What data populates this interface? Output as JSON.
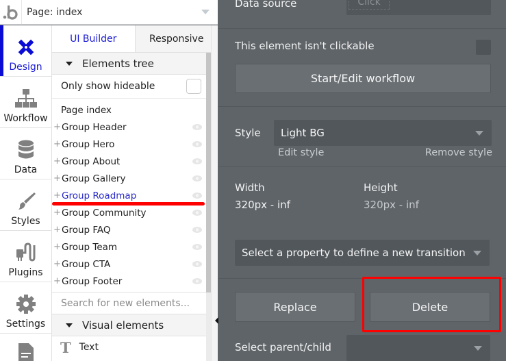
{
  "header": {
    "logo_icon": "bubble-logo-icon",
    "page_selector": "Page: index"
  },
  "rail": {
    "items": [
      {
        "label": "Design",
        "icon": "design-tools-icon",
        "active": true
      },
      {
        "label": "Workflow",
        "icon": "workflow-tree-icon",
        "active": false
      },
      {
        "label": "Data",
        "icon": "database-icon",
        "active": false
      },
      {
        "label": "Styles",
        "icon": "paintbrush-icon",
        "active": false
      },
      {
        "label": "Plugins",
        "icon": "plug-icon",
        "active": false
      },
      {
        "label": "Settings",
        "icon": "gear-icon",
        "active": false
      },
      {
        "label": "",
        "icon": "document-icon",
        "active": false
      }
    ]
  },
  "elements_panel": {
    "tabs": [
      {
        "label": "UI Builder",
        "active": true
      },
      {
        "label": "Responsive",
        "active": false
      }
    ],
    "elements_tree_header": "Elements tree",
    "only_show_hideable": "Only show hideable",
    "root": "Page index",
    "tree_items": [
      {
        "label": "Group Header",
        "selected": false
      },
      {
        "label": "Group Hero",
        "selected": false
      },
      {
        "label": "Group About",
        "selected": false
      },
      {
        "label": "Group Gallery",
        "selected": false
      },
      {
        "label": "Group Roadmap",
        "selected": true
      },
      {
        "label": "Group Community",
        "selected": false
      },
      {
        "label": "Group FAQ",
        "selected": false
      },
      {
        "label": "Group Team",
        "selected": false
      },
      {
        "label": "Group CTA",
        "selected": false
      },
      {
        "label": "Group Footer",
        "selected": false
      }
    ],
    "search_placeholder": "Search for new elements...",
    "visual_elements_header": "Visual elements",
    "visual_elements": [
      {
        "label": "Text",
        "icon_glyph": "T"
      }
    ]
  },
  "properties": {
    "data_source_label": "Data source",
    "data_source_chip": "Click",
    "not_clickable_label": "This element isn't clickable",
    "workflow_button": "Start/Edit workflow",
    "style_label": "Style",
    "style_value": "Light BG",
    "edit_style": "Edit style",
    "remove_style": "Remove style",
    "width_label": "Width",
    "width_value": "320px - inf",
    "height_label": "Height",
    "height_value": "320px - inf",
    "transition_select": "Select a property to define a new transition",
    "replace_button": "Replace",
    "delete_button": "Delete",
    "parent_child_label": "Select parent/child",
    "parent_child_value": ""
  },
  "colors": {
    "accent_blue": "#0b0bd6",
    "selected_text": "#2828c8",
    "highlight_red": "#ff0000",
    "panel_dark": "#5f6468"
  }
}
